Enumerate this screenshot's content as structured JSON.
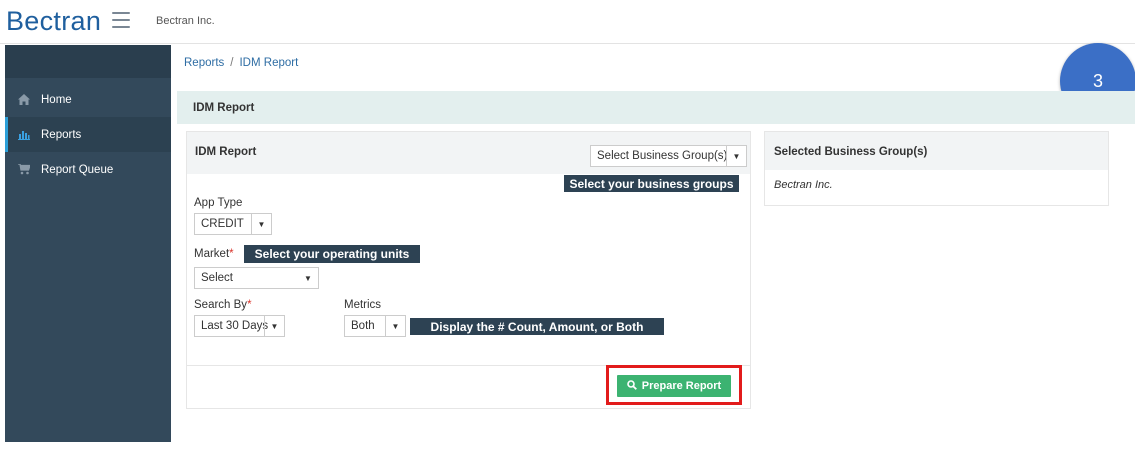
{
  "header": {
    "logo_text": "Bectran",
    "company": "Bectran Inc."
  },
  "sidebar": {
    "items": [
      {
        "label": "Home",
        "icon": "home-icon"
      },
      {
        "label": "Reports",
        "icon": "bar-chart-icon",
        "active": true
      },
      {
        "label": "Report Queue",
        "icon": "cart-icon"
      }
    ]
  },
  "breadcrumb": {
    "root": "Reports",
    "separator": "/",
    "current": "IDM Report"
  },
  "step_badge": "3",
  "page_title": "IDM Report",
  "form": {
    "title": "IDM Report",
    "business_group_select": "Select Business Group(s)",
    "callout_business_groups": "Select your business groups",
    "app_type": {
      "label": "App Type",
      "value": "CREDIT"
    },
    "market": {
      "label": "Market",
      "required_mark": "*",
      "value": "Select"
    },
    "callout_operating_units": "Select your operating units",
    "search_by": {
      "label": "Search By",
      "required_mark": "*",
      "value": "Last 30 Days"
    },
    "metrics": {
      "label": "Metrics",
      "value": "Both"
    },
    "callout_metrics": "Display the # Count, Amount, or Both",
    "prepare_button": "Prepare Report"
  },
  "selected_groups": {
    "title": "Selected Business Group(s)",
    "value": "Bectran Inc."
  },
  "colors": {
    "sidebar": "#33495b",
    "accent_blue": "#2c9fd8",
    "button_green": "#3cb371",
    "highlight_red": "#e21b1b",
    "callout": "#2d4253",
    "badge": "#3b6fc6"
  }
}
